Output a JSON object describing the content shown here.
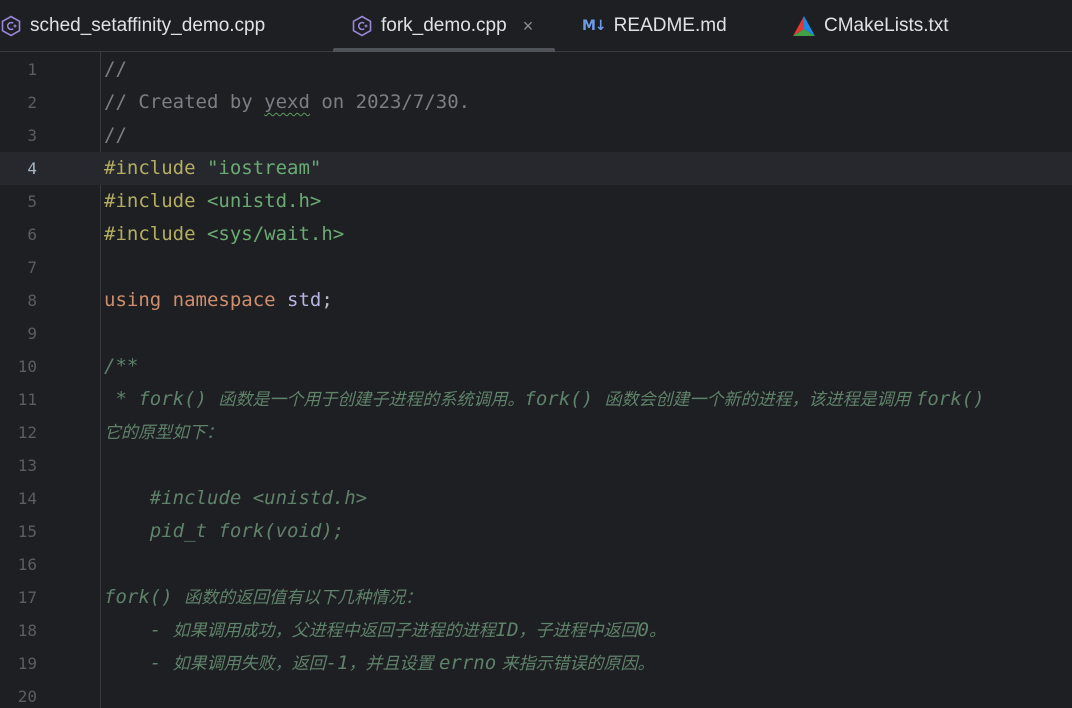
{
  "tabs": [
    {
      "label": "sched_setaffinity_demo.cpp",
      "icon": "cpp-file-icon",
      "active": false
    },
    {
      "label": "fork_demo.cpp",
      "icon": "cpp-file-icon",
      "active": true,
      "close": "×"
    },
    {
      "label": "README.md",
      "icon": "markdown-file-icon",
      "icon_text": "M↓",
      "active": false
    },
    {
      "label": "CMakeLists.txt",
      "icon": "cmake-file-icon",
      "active": false
    }
  ],
  "editor": {
    "current_line": 4,
    "lines": [
      {
        "n": "1",
        "segments": [
          {
            "t": "//",
            "c": "comment"
          }
        ]
      },
      {
        "n": "2",
        "segments": [
          {
            "t": "// Created by ",
            "c": "comment"
          },
          {
            "t": "yexd",
            "c": "comment typo"
          },
          {
            "t": " on 2023/7/30.",
            "c": "comment"
          }
        ]
      },
      {
        "n": "3",
        "segments": [
          {
            "t": "//",
            "c": "comment"
          }
        ]
      },
      {
        "n": "4",
        "segments": [
          {
            "t": "#include ",
            "c": "pp"
          },
          {
            "t": "\"iostream\"",
            "c": "str"
          }
        ]
      },
      {
        "n": "5",
        "segments": [
          {
            "t": "#include ",
            "c": "pp"
          },
          {
            "t": "<unistd.h>",
            "c": "str"
          }
        ]
      },
      {
        "n": "6",
        "segments": [
          {
            "t": "#include ",
            "c": "pp"
          },
          {
            "t": "<sys/wait.h>",
            "c": "str"
          }
        ]
      },
      {
        "n": "7",
        "segments": []
      },
      {
        "n": "8",
        "segments": [
          {
            "t": "using ",
            "c": "kw"
          },
          {
            "t": "namespace ",
            "c": "kw"
          },
          {
            "t": "std",
            "c": "ns"
          },
          {
            "t": ";",
            "c": "plain"
          }
        ]
      },
      {
        "n": "9",
        "segments": []
      },
      {
        "n": "10",
        "segments": [
          {
            "t": "/**",
            "c": "doc"
          }
        ]
      },
      {
        "n": "11",
        "segments": [
          {
            "t": " * fork() ",
            "c": "doc"
          },
          {
            "t": "函数是一个用于创建子进程的系统调用。",
            "c": "doc-cjk"
          },
          {
            "t": "fork() ",
            "c": "doc"
          },
          {
            "t": "函数会创建一个新的进程，该进程是调用 ",
            "c": "doc-cjk"
          },
          {
            "t": "fork()",
            "c": "doc"
          }
        ]
      },
      {
        "n": "12",
        "segments": [
          {
            "t": "它的原型如下：",
            "c": "doc-cjk"
          }
        ]
      },
      {
        "n": "13",
        "segments": []
      },
      {
        "n": "14",
        "segments": [
          {
            "t": "    #include <unistd.h>",
            "c": "doc"
          }
        ]
      },
      {
        "n": "15",
        "segments": [
          {
            "t": "    pid_t fork(void);",
            "c": "doc"
          }
        ]
      },
      {
        "n": "16",
        "segments": []
      },
      {
        "n": "17",
        "segments": [
          {
            "t": "fork() ",
            "c": "doc"
          },
          {
            "t": "函数的返回值有以下几种情况：",
            "c": "doc-cjk"
          }
        ]
      },
      {
        "n": "18",
        "segments": [
          {
            "t": "    - ",
            "c": "doc"
          },
          {
            "t": "如果调用成功，父进程中返回子进程的进程",
            "c": "doc-cjk"
          },
          {
            "t": "ID",
            "c": "doc"
          },
          {
            "t": "，子进程中返回",
            "c": "doc-cjk"
          },
          {
            "t": "0",
            "c": "doc"
          },
          {
            "t": "。",
            "c": "doc-cjk"
          }
        ]
      },
      {
        "n": "19",
        "segments": [
          {
            "t": "    - ",
            "c": "doc"
          },
          {
            "t": "如果调用失败，返回",
            "c": "doc-cjk"
          },
          {
            "t": "-1",
            "c": "doc"
          },
          {
            "t": "，并且设置 ",
            "c": "doc-cjk"
          },
          {
            "t": "errno",
            "c": "doc"
          },
          {
            "t": " 来指示错误的原因。",
            "c": "doc-cjk"
          }
        ]
      },
      {
        "n": "20",
        "segments": []
      }
    ]
  },
  "colors": {
    "background": "#1e1f22",
    "current_line": "#26282e",
    "comment": "#7a7e85",
    "doc_comment": "#5f826b",
    "preprocessor": "#b3ae60",
    "string": "#6aab73",
    "keyword": "#cf8e6d",
    "namespace": "#b5b6e3"
  }
}
